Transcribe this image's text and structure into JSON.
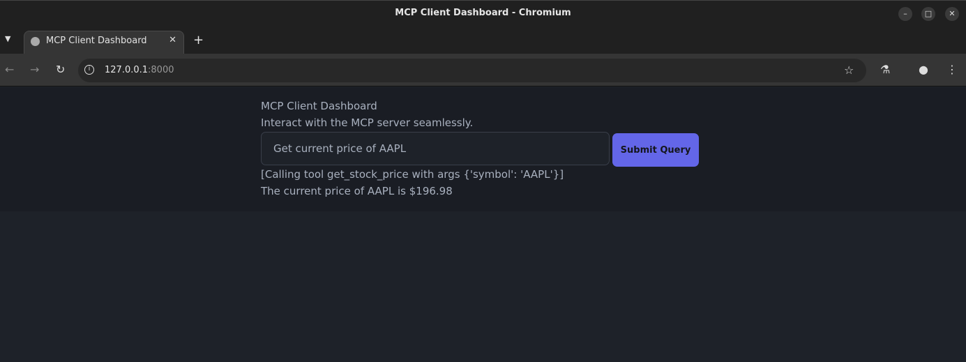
{
  "window": {
    "title": "MCP Client Dashboard - Chromium"
  },
  "tab": {
    "title": "MCP Client Dashboard"
  },
  "address": {
    "host": "127.0.0.1",
    "port": ":8000"
  },
  "page": {
    "title": "MCP Client Dashboard",
    "subtitle": "Interact with the MCP server seamlessly.",
    "query_value": "Get current price of AAPL",
    "submit_label": "Submit Query",
    "output": [
      "[Calling tool get_stock_price with args {'symbol': 'AAPL'}]",
      "The current price of AAPL is $196.98"
    ]
  },
  "colors": {
    "accent": "#6366e8",
    "background": "#1e2229"
  }
}
